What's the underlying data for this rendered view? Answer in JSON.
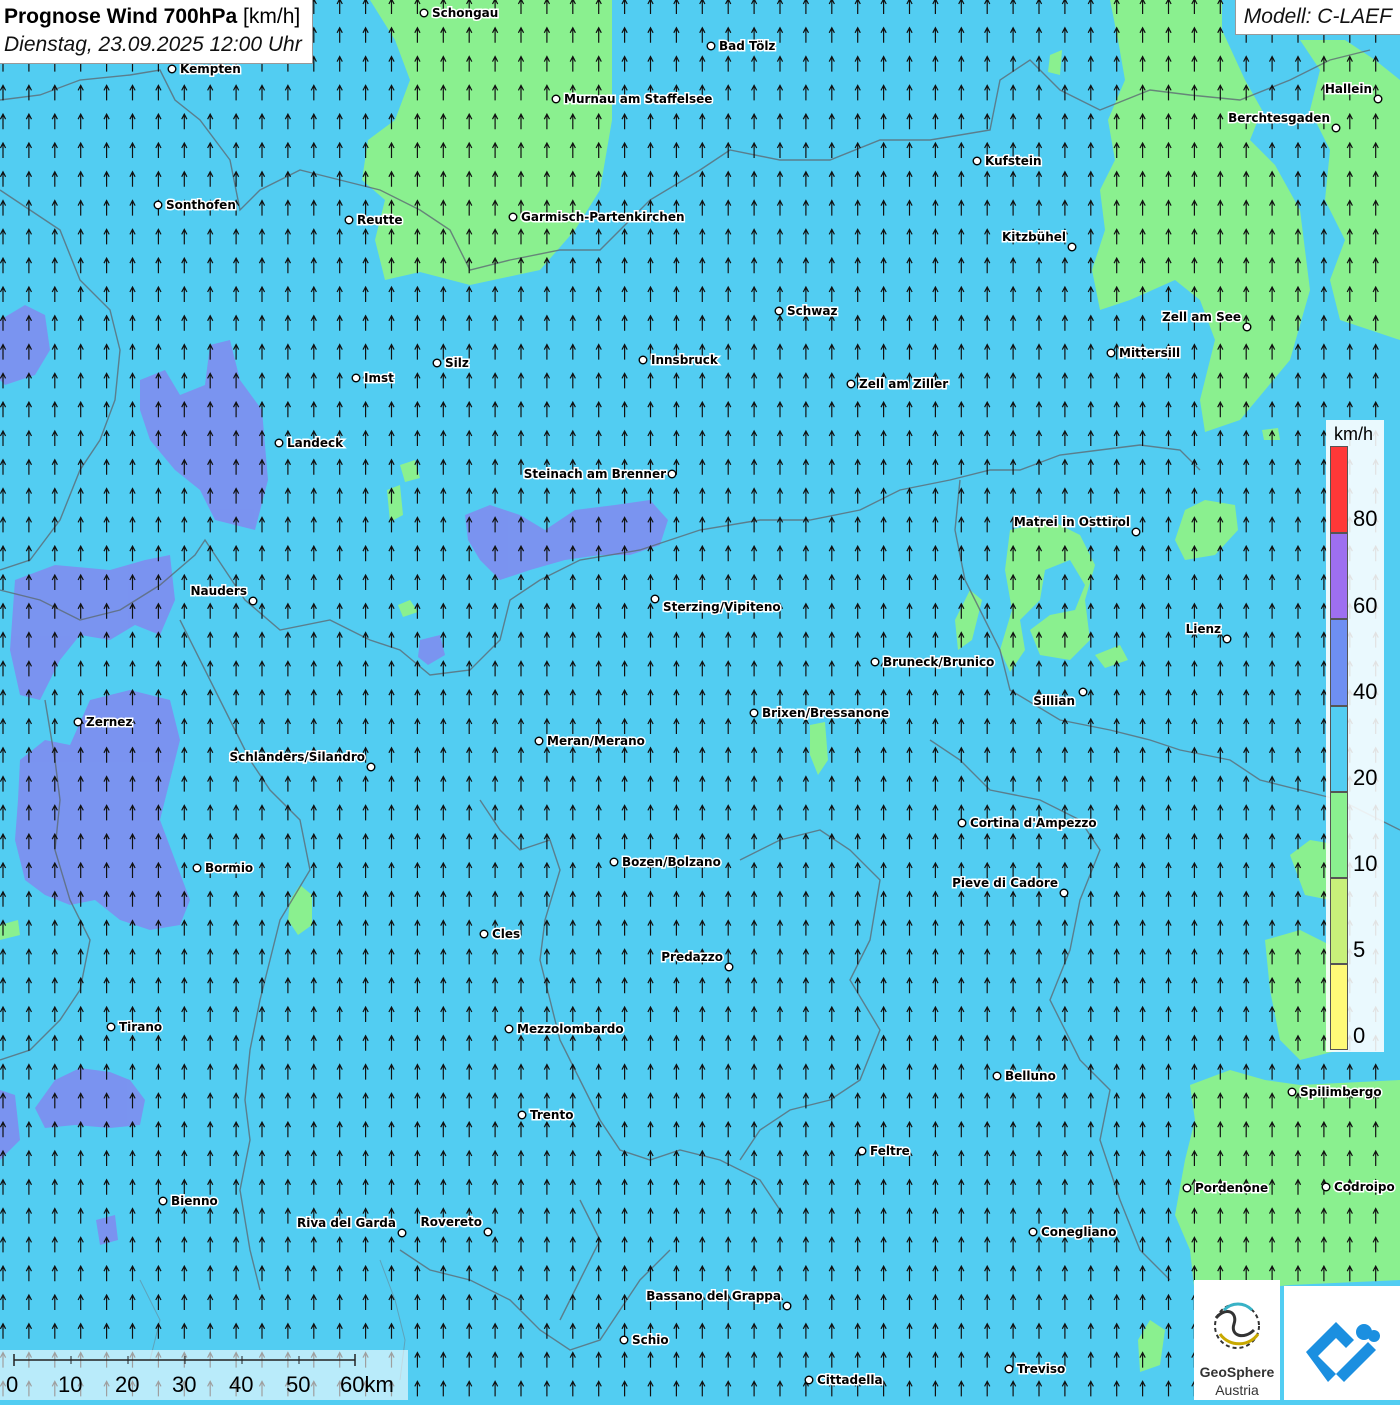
{
  "title": {
    "main_bold": "Prognose Wind 700hPa",
    "main_unit": "[km/h]",
    "datetime": "Dienstag, 23.09.2025 12:00 Uhr"
  },
  "model": "Modell: C-LAEF",
  "legend": {
    "unit": "km/h",
    "ticks": [
      "80",
      "60",
      "40",
      "20",
      "10",
      "5",
      "0"
    ],
    "classes": [
      {
        "range": "60-80+",
        "color": "#ff3838"
      },
      {
        "range": "50-60",
        "color": "#9e6ff0"
      },
      {
        "range": "40-50",
        "color": "#6e8ff2"
      },
      {
        "range": "20-40",
        "color": "#52cdf2"
      },
      {
        "range": "10-20",
        "color": "#8af08f"
      },
      {
        "range": "5-10",
        "color": "#c8f07a"
      },
      {
        "range": "0-5",
        "color": "#fffa78"
      }
    ]
  },
  "scale_bar": {
    "labels": [
      "0",
      "10",
      "20",
      "30",
      "40",
      "50",
      "60km"
    ]
  },
  "wind": {
    "predominant_direction": "north",
    "field_color": "#52cdf2"
  },
  "cities": [
    {
      "name": "Schongau"
    },
    {
      "name": "Bad Tölz"
    },
    {
      "name": "Kempten"
    },
    {
      "name": "Murnau am Staffelsee"
    },
    {
      "name": "Hallein"
    },
    {
      "name": "Berchtesgaden"
    },
    {
      "name": "Kufstein"
    },
    {
      "name": "Sonthofen"
    },
    {
      "name": "Reutte"
    },
    {
      "name": "Garmisch-Partenkirchen"
    },
    {
      "name": "Kitzbühel"
    },
    {
      "name": "Schwaz"
    },
    {
      "name": "Zell am See"
    },
    {
      "name": "Mittersill"
    },
    {
      "name": "Silz"
    },
    {
      "name": "Innsbruck"
    },
    {
      "name": "Imst"
    },
    {
      "name": "Zell am Ziller"
    },
    {
      "name": "Landeck"
    },
    {
      "name": "Steinach am Brenner"
    },
    {
      "name": "Matrei in Osttirol"
    },
    {
      "name": "Nauders"
    },
    {
      "name": "Sterzing/Vipiteno"
    },
    {
      "name": "Lienz"
    },
    {
      "name": "Bruneck/Brunico"
    },
    {
      "name": "Sillian"
    },
    {
      "name": "Zernez"
    },
    {
      "name": "Brixen/Bressanone"
    },
    {
      "name": "Meran/Merano"
    },
    {
      "name": "Schlanders/Silandro"
    },
    {
      "name": "Cortina d'Ampezzo"
    },
    {
      "name": "Bozen/Bolzano"
    },
    {
      "name": "Bormio"
    },
    {
      "name": "Pieve di Cadore"
    },
    {
      "name": "Cles"
    },
    {
      "name": "Predazzo"
    },
    {
      "name": "Tirano"
    },
    {
      "name": "Mezzolombardo"
    },
    {
      "name": "Belluno"
    },
    {
      "name": "Spilimbergo"
    },
    {
      "name": "Trento"
    },
    {
      "name": "Feltre"
    },
    {
      "name": "Pordenone"
    },
    {
      "name": "Codroipo"
    },
    {
      "name": "Bienno"
    },
    {
      "name": "Riva del Garda"
    },
    {
      "name": "Rovereto"
    },
    {
      "name": "Conegliano"
    },
    {
      "name": "Bassano del Grappa"
    },
    {
      "name": "Schio"
    },
    {
      "name": "Treviso"
    },
    {
      "name": "Cittadella"
    }
  ],
  "logos": {
    "geosphere_line1": "GeoSphere",
    "geosphere_line2": "Austria"
  }
}
